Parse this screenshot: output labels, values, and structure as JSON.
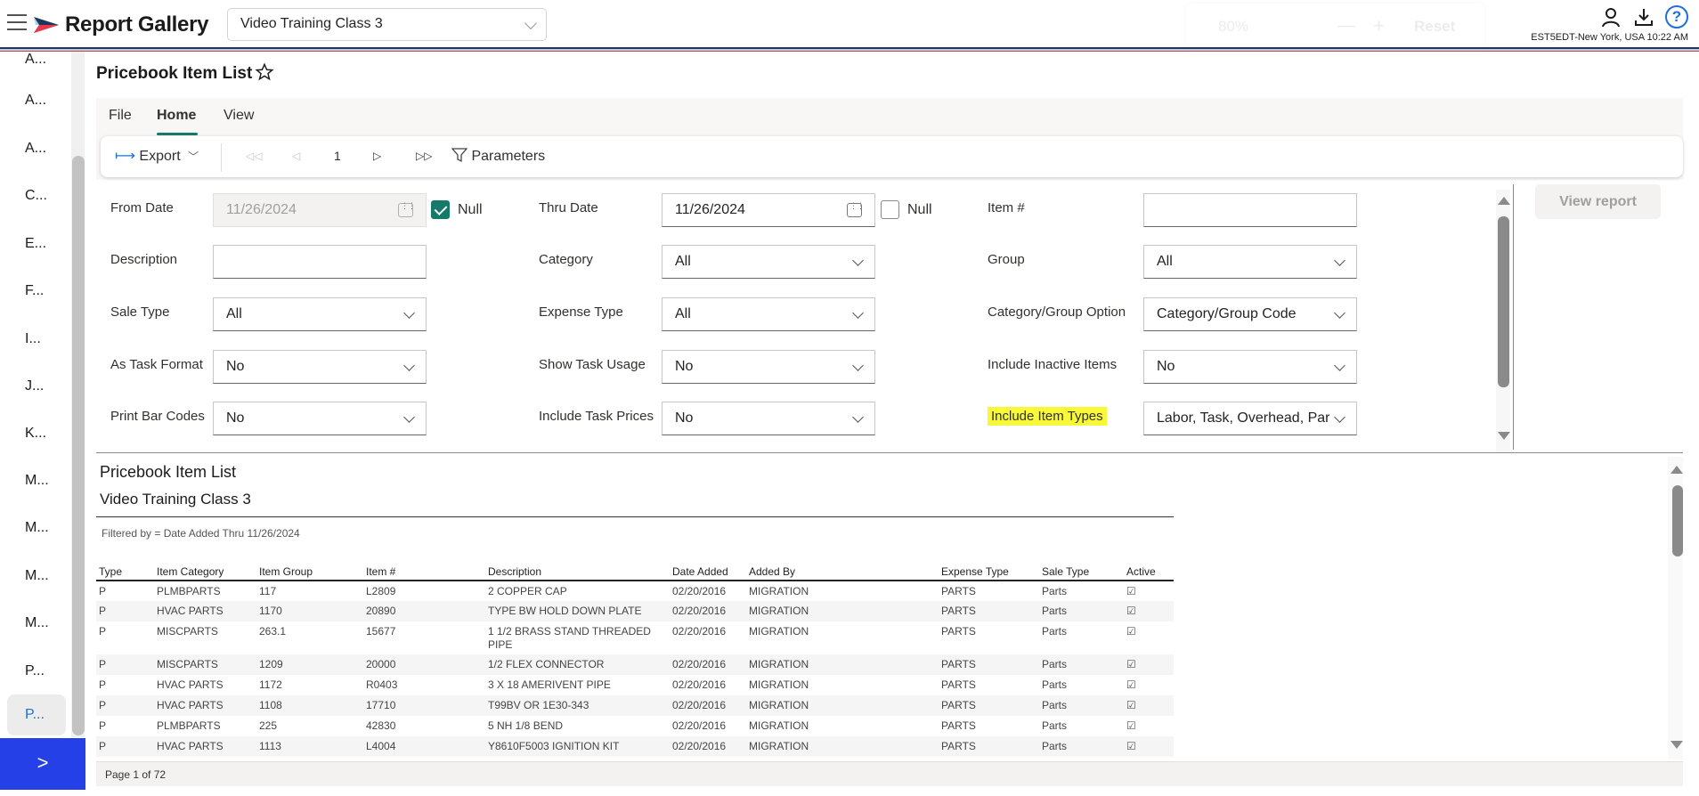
{
  "header": {
    "app_title": "Report Gallery",
    "company_select": "Video Training Class 3",
    "zoom_overlay": {
      "percent": "80%",
      "minus": "—",
      "plus": "+",
      "reset": "Reset"
    },
    "help_glyph": "?",
    "timezone": "EST5EDT-New York, USA 10:22 AM",
    "colors": {
      "stripe_navy": "#1f3560",
      "stripe_blue": "#a9d4df",
      "stripe_red": "#e8394a"
    }
  },
  "sidebar": {
    "items": [
      {
        "label": "A..."
      },
      {
        "label": "A..."
      },
      {
        "label": "A..."
      },
      {
        "label": "C..."
      },
      {
        "label": "E..."
      },
      {
        "label": "F..."
      },
      {
        "label": "I..."
      },
      {
        "label": "J..."
      },
      {
        "label": "K..."
      },
      {
        "label": "M..."
      },
      {
        "label": "M..."
      },
      {
        "label": "M..."
      },
      {
        "label": "M..."
      },
      {
        "label": "P..."
      },
      {
        "label": "P...",
        "active": true
      }
    ],
    "expand_glyph": ">",
    "accent": "#2440e6"
  },
  "page": {
    "title": "Pricebook Item List"
  },
  "ribbon": {
    "tabs": [
      "File",
      "Home",
      "View"
    ],
    "active_tab": "Home",
    "toolbar": {
      "export_label": "Export",
      "first_glyph": "◁◁",
      "prev_glyph": "◁",
      "page_number": "1",
      "next_glyph": "▷",
      "last_glyph": "▷▷",
      "parameters_label": "Parameters"
    }
  },
  "params": {
    "from_date": {
      "label": "From Date",
      "value": "11/26/2024",
      "null_label": "Null",
      "null_checked": true
    },
    "thru_date": {
      "label": "Thru Date",
      "value": "11/26/2024",
      "null_label": "Null",
      "null_checked": false
    },
    "item_number": {
      "label": "Item #",
      "value": ""
    },
    "description": {
      "label": "Description",
      "value": ""
    },
    "category": {
      "label": "Category",
      "value": "All"
    },
    "group": {
      "label": "Group",
      "value": "All"
    },
    "sale_type": {
      "label": "Sale Type",
      "value": "All"
    },
    "expense_type": {
      "label": "Expense Type",
      "value": "All"
    },
    "category_group_option": {
      "label": "Category/Group Option",
      "value": "Category/Group Code"
    },
    "as_task_format": {
      "label": "As Task Format",
      "value": "No"
    },
    "show_task_usage": {
      "label": "Show Task Usage",
      "value": "No"
    },
    "include_inactive_items": {
      "label": "Include Inactive Items",
      "value": "No"
    },
    "print_bar_codes": {
      "label": "Print Bar Codes",
      "value": "No"
    },
    "include_task_prices": {
      "label": "Include Task Prices",
      "value": "No"
    },
    "include_item_types": {
      "label": "Include Item Types",
      "value": "Labor, Task, Overhead, Parts"
    },
    "view_report_label": "View report"
  },
  "report": {
    "title": "Pricebook Item List",
    "subtitle": "Video Training Class 3",
    "filter": "Filtered by = Date Added Thru 11/26/2024",
    "columns": [
      "Type",
      "Item Category",
      "Item Group",
      "Item #",
      "Description",
      "Date Added",
      "Added By",
      "Expense Type",
      "Sale Type",
      "Active"
    ],
    "rows": [
      [
        "P",
        "PLMBPARTS",
        "117",
        "L2809",
        "2 COPPER CAP",
        "02/20/2016",
        "MIGRATION",
        "PARTS",
        "Parts",
        "☑"
      ],
      [
        "P",
        "HVAC PARTS",
        "1170",
        "20890",
        "TYPE BW HOLD DOWN PLATE",
        "02/20/2016",
        "MIGRATION",
        "PARTS",
        "Parts",
        "☑"
      ],
      [
        "P",
        "MISCPARTS",
        "263.1",
        "15677",
        "1 1/2 BRASS STAND THREADED PIPE",
        "02/20/2016",
        "MIGRATION",
        "PARTS",
        "Parts",
        "☑"
      ],
      [
        "P",
        "MISCPARTS",
        "1209",
        "20000",
        "1/2 FLEX CONNECTOR",
        "02/20/2016",
        "MIGRATION",
        "PARTS",
        "Parts",
        "☑"
      ],
      [
        "P",
        "HVAC PARTS",
        "1172",
        "R0403",
        "3 X 18 AMERIVENT PIPE",
        "02/20/2016",
        "MIGRATION",
        "PARTS",
        "Parts",
        "☑"
      ],
      [
        "P",
        "HVAC PARTS",
        "1108",
        "17710",
        "T99BV OR 1E30-343",
        "02/20/2016",
        "MIGRATION",
        "PARTS",
        "Parts",
        "☑"
      ],
      [
        "P",
        "PLMBPARTS",
        "225",
        "42830",
        "5 NH 1/8 BEND",
        "02/20/2016",
        "MIGRATION",
        "PARTS",
        "Parts",
        "☑"
      ],
      [
        "P",
        "HVAC PARTS",
        "1113",
        "L4004",
        "Y8610F5003 IGNITION KIT",
        "02/20/2016",
        "MIGRATION",
        "PARTS",
        "Parts",
        "☑"
      ]
    ],
    "page_status": "Page 1 of 72"
  }
}
